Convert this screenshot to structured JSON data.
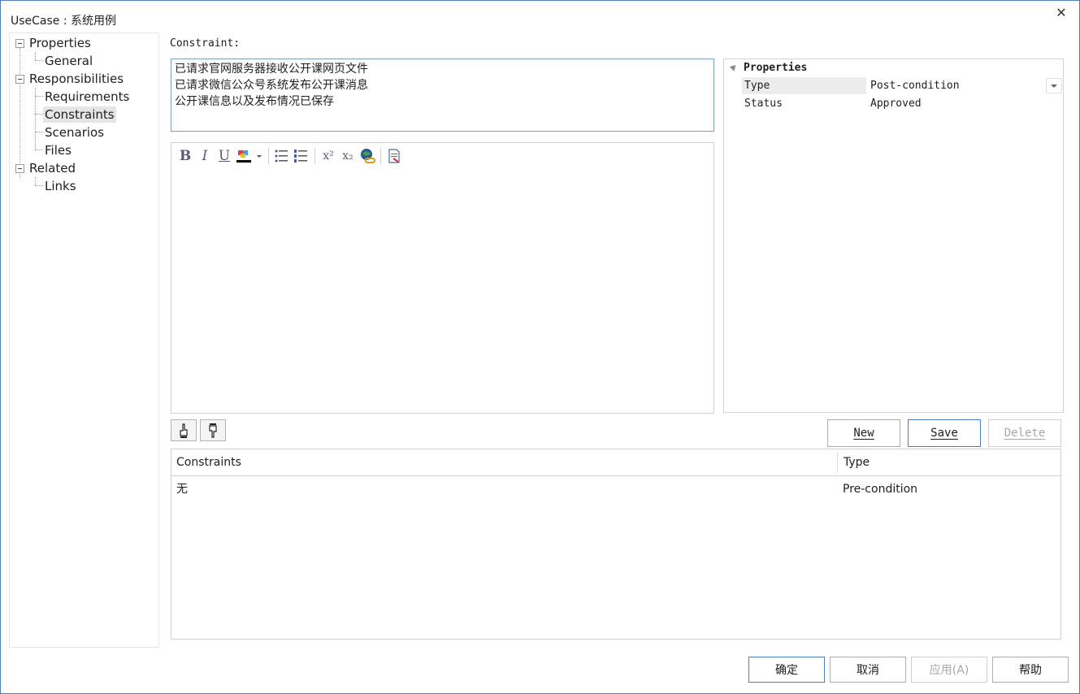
{
  "window": {
    "title": "UseCase : 系统用例",
    "close_glyph": "✕"
  },
  "tree": {
    "items": [
      {
        "label": "Properties"
      },
      {
        "label": "General"
      },
      {
        "label": "Responsibilities"
      },
      {
        "label": "Requirements"
      },
      {
        "label": "Constraints",
        "selected": true
      },
      {
        "label": "Scenarios"
      },
      {
        "label": "Files"
      },
      {
        "label": "Related"
      },
      {
        "label": "Links"
      }
    ]
  },
  "constraint": {
    "label": "Constraint:",
    "lines": [
      "已请求官网服务器接收公开课网页文件",
      "已请求微信公众号系统发布公开课消息",
      "公开课信息以及发布情况已保存"
    ]
  },
  "toolbar": {
    "bold": "B",
    "italic": "I",
    "underline": "U",
    "superscript": "x²",
    "subscript": "x₂",
    "icons": [
      "bold-icon",
      "italic-icon",
      "underline-icon",
      "font-color-icon",
      "bullet-list-icon",
      "numbered-list-icon",
      "superscript-icon",
      "subscript-icon",
      "hyperlink-icon",
      "document-icon"
    ]
  },
  "properties": {
    "header": "Properties",
    "rows": [
      {
        "key": "Type",
        "value": "Post-condition"
      },
      {
        "key": "Status",
        "value": "Approved"
      }
    ]
  },
  "actions": {
    "new": "New",
    "save": "Save",
    "delete": "Delete"
  },
  "list": {
    "columns": [
      "Constraints",
      "Type"
    ],
    "rows": [
      {
        "constraint": "无",
        "type": "Pre-condition"
      }
    ]
  },
  "dialog_buttons": {
    "ok": "确定",
    "cancel": "取消",
    "apply": "应用(A)",
    "help": "帮助"
  },
  "colors": {
    "accent_border": "#4a7fb8",
    "selected_bg": "#e5e5e5",
    "font_color_bar": "#000000"
  }
}
